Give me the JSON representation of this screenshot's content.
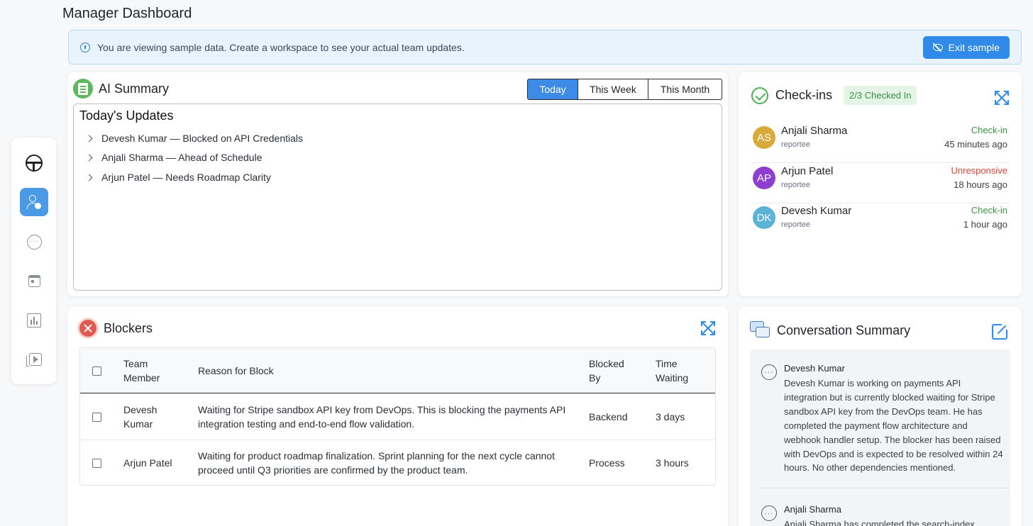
{
  "page": {
    "title": "Manager Dashboard"
  },
  "banner": {
    "message": "You are viewing sample data. Create a workspace to see your actual team updates.",
    "exit_label": "Exit sample"
  },
  "sidebar": {
    "items": [
      {
        "name": "logo",
        "icon": "logo-icon"
      },
      {
        "name": "team",
        "icon": "user-settings-icon",
        "active": true
      },
      {
        "name": "chat",
        "icon": "chat-icon"
      },
      {
        "name": "calendar",
        "icon": "calendar-icon"
      },
      {
        "name": "reports",
        "icon": "bar-chart-icon"
      },
      {
        "name": "media",
        "icon": "video-library-icon"
      }
    ]
  },
  "ai_summary": {
    "title": "AI Summary",
    "tabs": [
      "Today",
      "This Week",
      "This Month"
    ],
    "active_tab": "Today",
    "box_title": "Today's Updates",
    "updates": [
      "Devesh Kumar — Blocked on API Credentials",
      "Anjali Sharma — Ahead of Schedule",
      "Arjun Patel — Needs Roadmap Clarity"
    ]
  },
  "checkins": {
    "title": "Check-ins",
    "badge": "2/3 Checked In",
    "people": [
      {
        "initials": "AS",
        "name": "Anjali Sharma",
        "role": "reportee",
        "status": "Check-in",
        "time": "45 minutes ago",
        "avatar_color": "#d9a93a",
        "status_color": "#3a9a3f"
      },
      {
        "initials": "AP",
        "name": "Arjun Patel",
        "role": "reportee",
        "status": "Unresponsive",
        "time": "18 hours ago",
        "avatar_color": "#8e3fd0",
        "status_color": "#d9443a"
      },
      {
        "initials": "DK",
        "name": "Devesh Kumar",
        "role": "reportee",
        "status": "Check-in",
        "time": "1 hour ago",
        "avatar_color": "#5bb3d6",
        "status_color": "#3a9a3f"
      }
    ]
  },
  "blockers": {
    "title": "Blockers",
    "columns": [
      "Team Member",
      "Reason for Block",
      "Blocked By",
      "Time Waiting"
    ],
    "rows": [
      {
        "member": "Devesh Kumar",
        "reason": "Waiting for Stripe sandbox API key from DevOps. This is blocking the payments API integration testing and end-to-end flow validation.",
        "blocked_by": "Backend",
        "waiting": "3 days"
      },
      {
        "member": "Arjun Patel",
        "reason": "Waiting for product roadmap finalization. Sprint planning for the next cycle cannot proceed until Q3 priorities are confirmed by the product team.",
        "blocked_by": "Process",
        "waiting": "3 hours"
      }
    ]
  },
  "conversation": {
    "title": "Conversation Summary",
    "entries": [
      {
        "name": "Devesh Kumar",
        "text": "Devesh Kumar is working on payments API integration but is currently blocked waiting for Stripe sandbox API key from the DevOps team. He has completed the payment flow architecture and webhook handler setup. The blocker has been raised with DevOps and is expected to be resolved within 24 hours. No other dependencies mentioned."
      },
      {
        "name": "Anjali Sharma",
        "text": "Anjali Sharma has completed the search-index"
      }
    ]
  },
  "colors": {
    "accent": "#2f8ae8",
    "success": "#4caf50",
    "danger": "#e05b4f"
  }
}
